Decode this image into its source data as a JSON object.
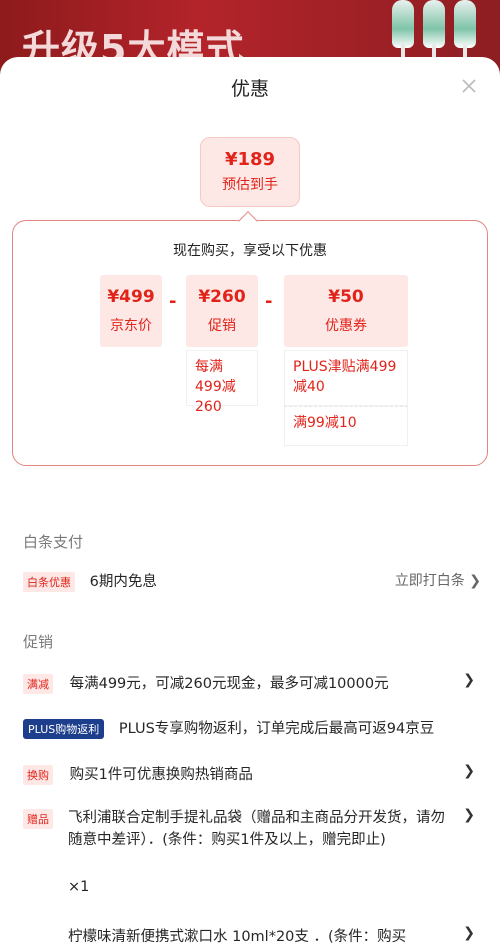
{
  "banner": {
    "text": "升级5大模式"
  },
  "sheet": {
    "title": "优惠"
  },
  "estimate": {
    "price": "¥189",
    "label": "预估到手"
  },
  "calc": {
    "heading": "现在购买，享受以下优惠",
    "items": [
      {
        "price": "¥499",
        "label": "京东价"
      },
      {
        "price": "¥260",
        "label": "促销"
      },
      {
        "price": "¥50",
        "label": "优惠券"
      }
    ],
    "operators": [
      "-",
      "-"
    ],
    "promo_detail": "每满499减260",
    "coupon_details": [
      "PLUS津贴满499减40",
      "满99减10"
    ]
  },
  "baitiao": {
    "section": "白条支付",
    "tag": "白条优惠",
    "text": "6期内免息",
    "link": "立即打白条 ❯"
  },
  "promo": {
    "section": "促销",
    "rows": [
      {
        "tag": "满减",
        "text": "每满499元，可减260元现金，最多可减10000元"
      },
      {
        "tag": "PLUS购物返利",
        "text": "PLUS专享购物返利，订单完成后最高可返94京豆"
      },
      {
        "tag": "换购",
        "text": "购买1件可优惠换购热销商品"
      },
      {
        "tag": "赠品",
        "text": "飞利浦联合定制手提礼品袋（赠品和主商品分开发货，请勿随意中差评）．(条件：购买1件及以上，赠完即止)",
        "qty": "×1"
      },
      {
        "text": "柠檬味清新便携式漱口水 10ml*20支 ．(条件：购买"
      }
    ],
    "chevron": "❯"
  },
  "colors": {
    "accent": "#e2231a",
    "tint": "#fde8e6",
    "plus": "#1d3e8c"
  },
  "icons": [
    "close-icon",
    "chevron-right-icon"
  ]
}
